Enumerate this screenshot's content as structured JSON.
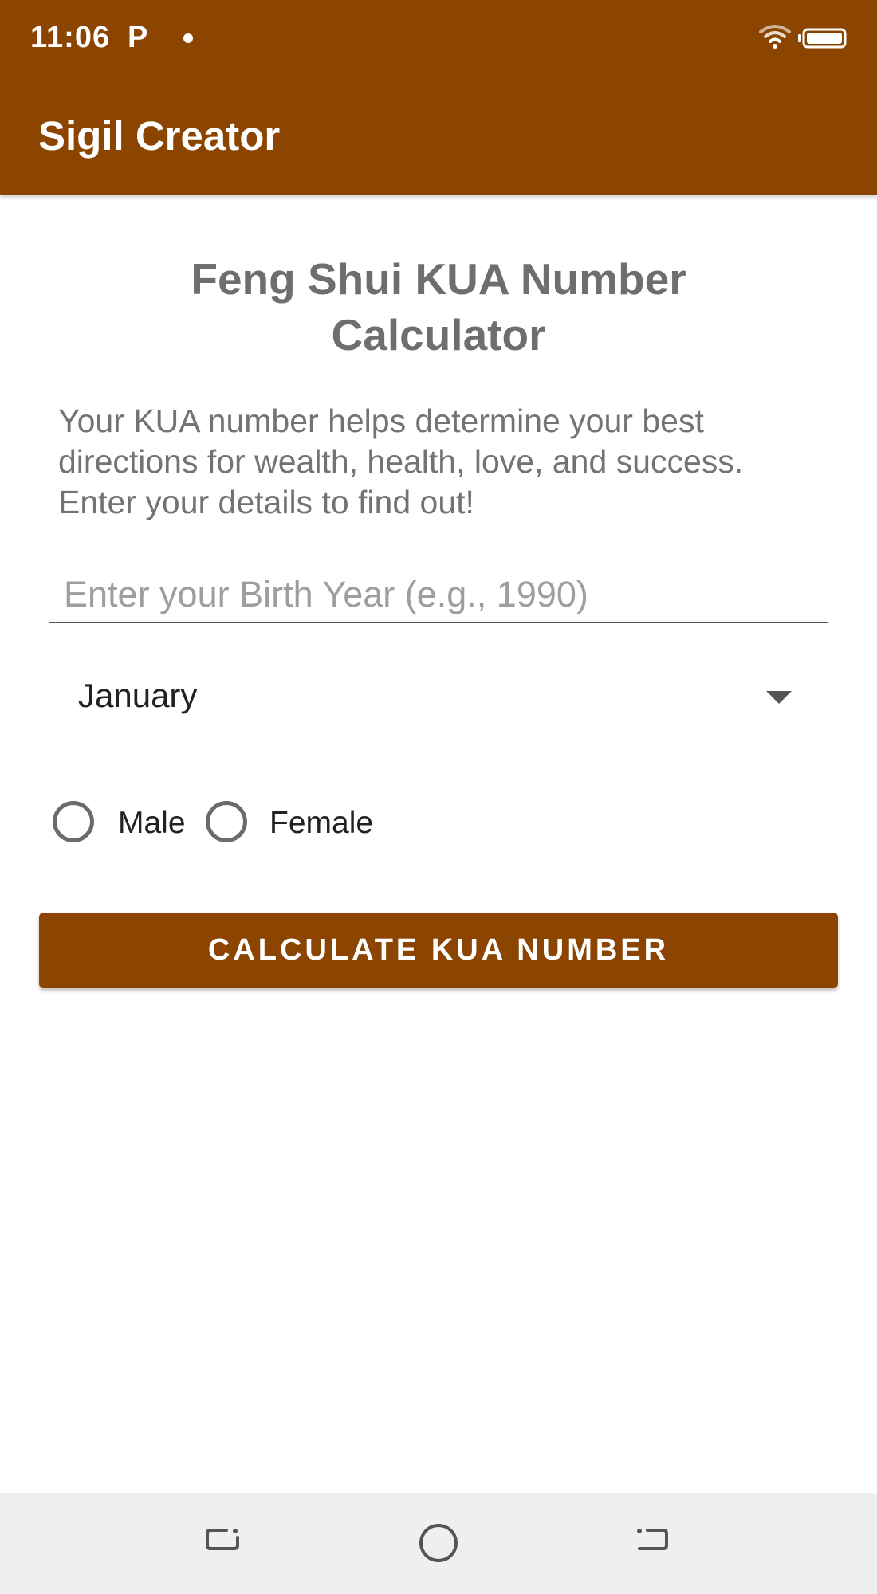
{
  "status_bar": {
    "time": "11:06",
    "notification_letter": "P"
  },
  "app_bar": {
    "title": "Sigil Creator"
  },
  "main": {
    "title": "Feng Shui KUA Number Calculator",
    "description": "Your KUA number helps determine your best directions for wealth, health, love, and success. Enter your details to find out!",
    "birth_year": {
      "placeholder": "Enter your Birth Year (e.g., 1990)",
      "value": ""
    },
    "month": {
      "selected": "January"
    },
    "gender": {
      "options": [
        "Male",
        "Female"
      ],
      "selected": null
    },
    "calculate_button": "CALCULATE KUA NUMBER"
  },
  "colors": {
    "primary": "#8B4500",
    "nav_background": "#efefef",
    "title_text": "#6e6e6e"
  },
  "icons": {
    "status": [
      "wifi-icon",
      "battery-icon"
    ],
    "navigation": [
      "recent-apps-icon",
      "home-icon",
      "back-icon"
    ]
  }
}
